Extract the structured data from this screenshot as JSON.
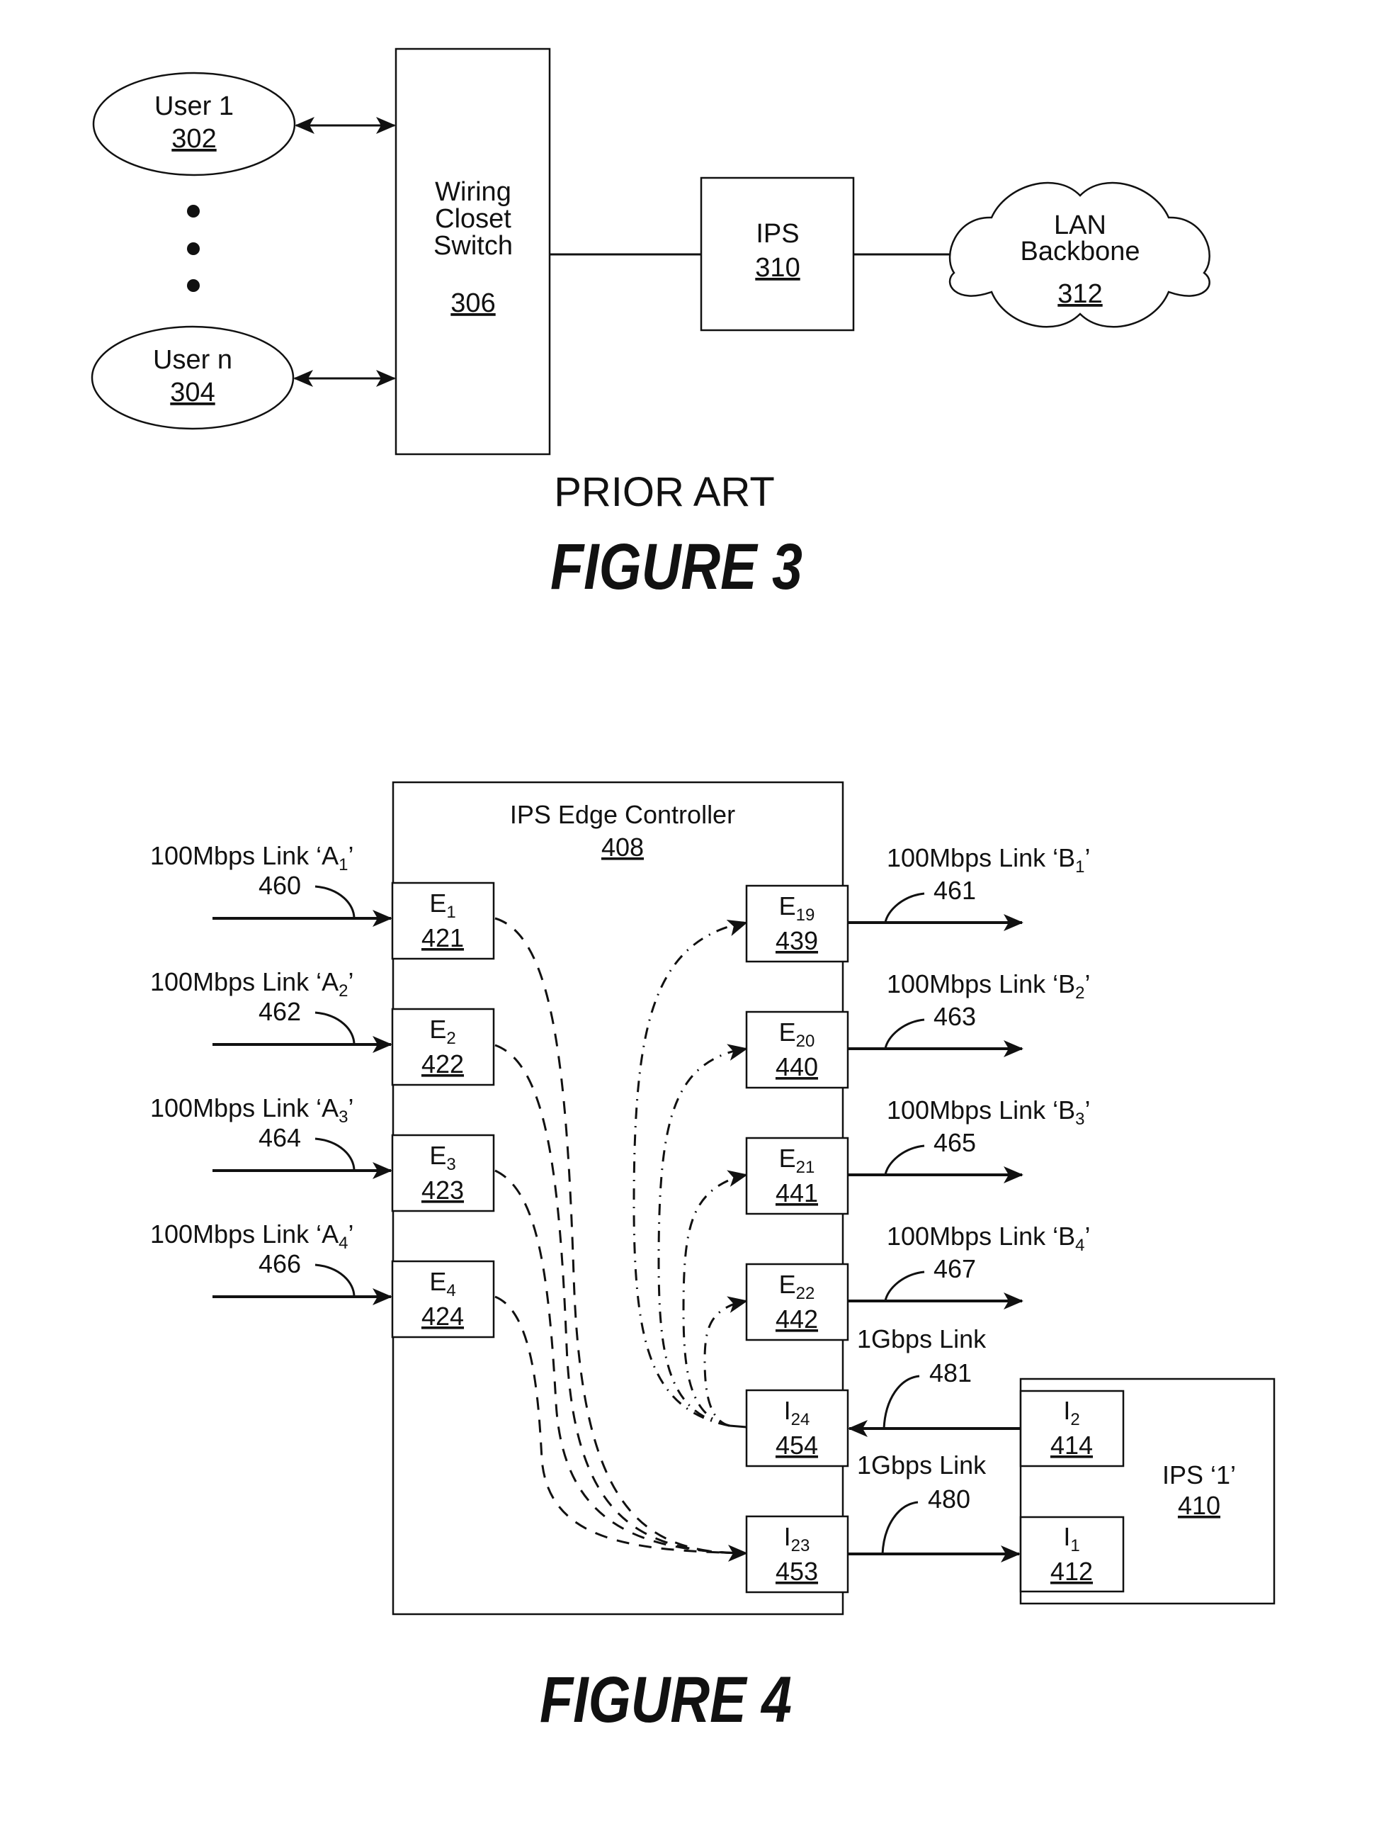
{
  "figure3": {
    "users": [
      {
        "name": "User 1",
        "ref": "302"
      },
      {
        "name": "User n",
        "ref": "304"
      }
    ],
    "ellipsis_icon": "vertical-dots",
    "switch": {
      "line1": "Wiring",
      "line2": "Closet",
      "line3": "Switch",
      "ref": "306"
    },
    "ips": {
      "name": "IPS",
      "ref": "310"
    },
    "backbone": {
      "line1": "LAN",
      "line2": "Backbone",
      "ref": "312"
    },
    "note": "PRIOR ART",
    "caption": "FIGURE 3"
  },
  "figure4": {
    "controller": {
      "name": "IPS Edge Controller",
      "ref": "408"
    },
    "inputs": [
      {
        "link": "100Mbps Link ‘A",
        "sub": "1",
        "close": "’",
        "link_ref": "460",
        "port": "E",
        "port_sub": "1",
        "port_ref": "421"
      },
      {
        "link": "100Mbps Link ‘A",
        "sub": "2",
        "close": "’",
        "link_ref": "462",
        "port": "E",
        "port_sub": "2",
        "port_ref": "422"
      },
      {
        "link": "100Mbps Link ‘A",
        "sub": "3",
        "close": "’",
        "link_ref": "464",
        "port": "E",
        "port_sub": "3",
        "port_ref": "423"
      },
      {
        "link": "100Mbps Link ‘A",
        "sub": "4",
        "close": "’",
        "link_ref": "466",
        "port": "E",
        "port_sub": "4",
        "port_ref": "424"
      }
    ],
    "outputs": [
      {
        "link": "100Mbps Link ‘B",
        "sub": "1",
        "close": "’",
        "link_ref": "461",
        "port": "E",
        "port_sub": "19",
        "port_ref": "439"
      },
      {
        "link": "100Mbps Link ‘B",
        "sub": "2",
        "close": "’",
        "link_ref": "463",
        "port": "E",
        "port_sub": "20",
        "port_ref": "440"
      },
      {
        "link": "100Mbps Link ‘B",
        "sub": "3",
        "close": "’",
        "link_ref": "465",
        "port": "E",
        "port_sub": "21",
        "port_ref": "441"
      },
      {
        "link": "100Mbps Link ‘B",
        "sub": "4",
        "close": "’",
        "link_ref": "467",
        "port": "E",
        "port_sub": "22",
        "port_ref": "442"
      }
    ],
    "internal_ports": [
      {
        "port": "I",
        "port_sub": "24",
        "port_ref": "454"
      },
      {
        "port": "I",
        "port_sub": "23",
        "port_ref": "453"
      }
    ],
    "gig_links": [
      {
        "label": "1Gbps Link",
        "ref": "481",
        "direction": "to-controller"
      },
      {
        "label": "1Gbps Link",
        "ref": "480",
        "direction": "to-ips"
      }
    ],
    "ips1": {
      "name": "IPS ‘1’",
      "ref": "410",
      "ports": [
        {
          "port": "I",
          "port_sub": "2",
          "port_ref": "414"
        },
        {
          "port": "I",
          "port_sub": "1",
          "port_ref": "412"
        }
      ]
    },
    "caption": "FIGURE 4"
  }
}
